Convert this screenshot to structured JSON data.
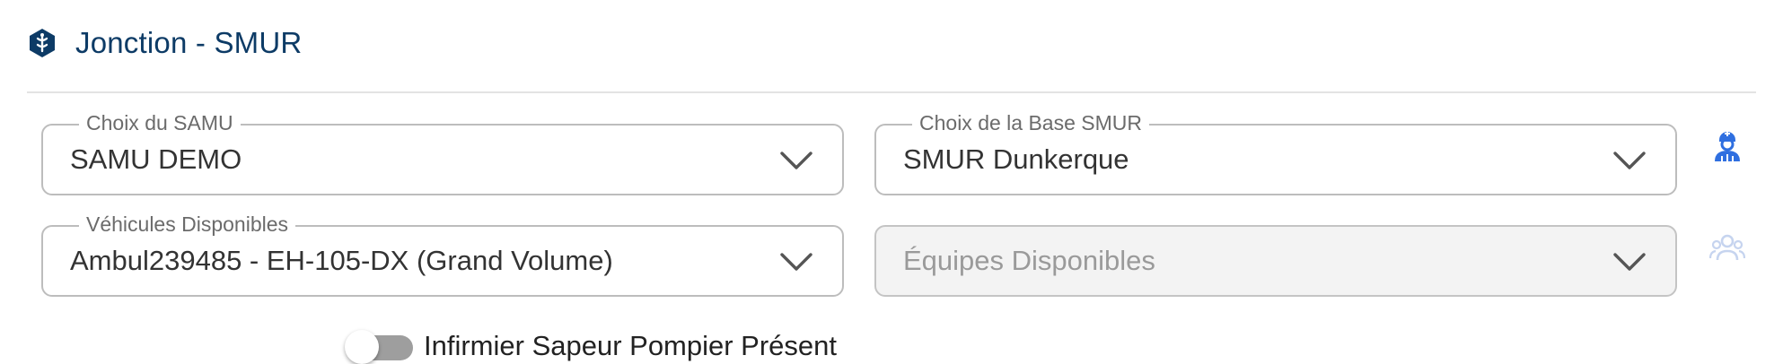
{
  "section": {
    "title": "Jonction - SMUR",
    "icon": "smur-hexagon-icon"
  },
  "fields": {
    "samu": {
      "label": "Choix du SAMU",
      "value": "SAMU DEMO"
    },
    "base_smur": {
      "label": "Choix de la Base SMUR",
      "value": "SMUR Dunkerque"
    },
    "vehicules": {
      "label": "Véhicules Disponibles",
      "value": "Ambul239485 - EH-105-DX (Grand Volume)"
    },
    "equipes": {
      "placeholder": "Équipes Disponibles",
      "disabled": true
    }
  },
  "side_icons": {
    "row1": "medical-staff-icon",
    "row2": "team-group-icon"
  },
  "toggle": {
    "label": "Infirmier Sapeur Pompier Présent",
    "checked": false
  },
  "colors": {
    "title": "#0d3b66",
    "accent_icon": "#2f6fe0",
    "disabled_icon": "#c6d4ef"
  }
}
